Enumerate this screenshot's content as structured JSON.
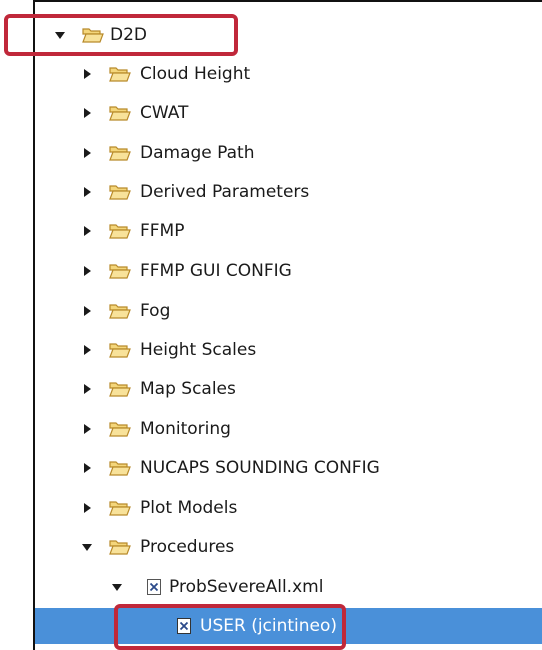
{
  "tree": {
    "root": {
      "label": "D2D",
      "expanded": true
    },
    "items": [
      {
        "label": "Cloud Height",
        "expanded": false
      },
      {
        "label": "CWAT",
        "expanded": false
      },
      {
        "label": "Damage Path",
        "expanded": false
      },
      {
        "label": "Derived Parameters",
        "expanded": false
      },
      {
        "label": "FFMP",
        "expanded": false
      },
      {
        "label": "FFMP GUI CONFIG",
        "expanded": false
      },
      {
        "label": "Fog",
        "expanded": false
      },
      {
        "label": "Height Scales",
        "expanded": false
      },
      {
        "label": "Map Scales",
        "expanded": false
      },
      {
        "label": "Monitoring",
        "expanded": false
      },
      {
        "label": "NUCAPS SOUNDING CONFIG",
        "expanded": false
      },
      {
        "label": "Plot Models",
        "expanded": false
      },
      {
        "label": "Procedures",
        "expanded": true
      }
    ],
    "file": {
      "label": "ProbSevereAll.xml",
      "expanded": true,
      "icon": "xml-file-icon"
    },
    "selected_leaf": {
      "label": "USER (jcintineo)",
      "icon": "xml-file-icon",
      "selected": true
    }
  },
  "colors": {
    "selection": "#4a90d9",
    "highlight_box": "#c0283a",
    "folder_fill": "#f4d67b",
    "folder_stroke": "#b88a2a"
  },
  "icons": {
    "expanded_arrow": "chevron-down-icon",
    "collapsed_arrow": "chevron-right-icon",
    "folder": "folder-icon"
  }
}
